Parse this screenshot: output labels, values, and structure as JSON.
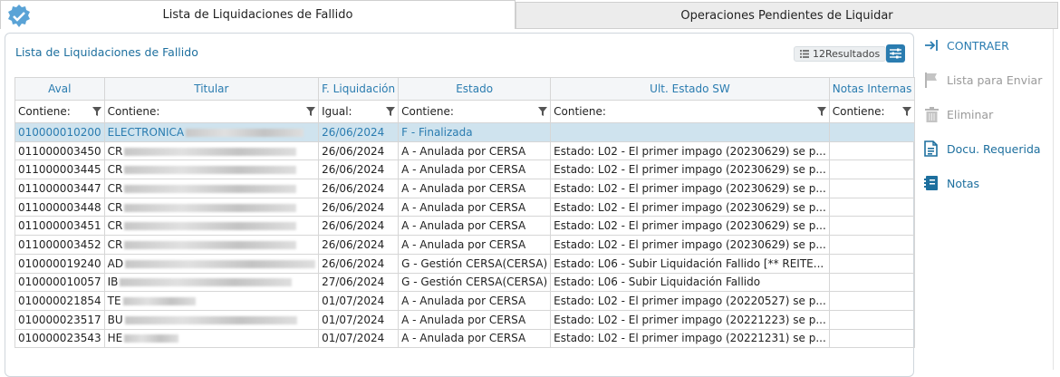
{
  "tabs": [
    {
      "label": "Lista de Liquidaciones de Fallido",
      "active": true
    },
    {
      "label": "Operaciones Pendientes de Liquidar",
      "active": false
    }
  ],
  "panel": {
    "title": "Lista de Liquidaciones de Fallido",
    "results_label": "12Resultados",
    "list_icon": "list-icon",
    "filter_icon": "sliders-icon"
  },
  "table": {
    "columns": [
      "Aval",
      "Titular",
      "F. Liquidación",
      "Estado",
      "Ult. Estado SW",
      "Notas Internas"
    ],
    "filters": [
      "Contiene:",
      "Contiene:",
      "Igual:",
      "Contiene:",
      "Contiene:",
      "Contiene:"
    ],
    "rows": [
      {
        "aval": "010000010200",
        "titular": "ELECTRONICA",
        "fecha": "26/06/2024",
        "estado": "F - Finalizada",
        "sw": "",
        "notas": ""
      },
      {
        "aval": "011000003450",
        "titular": "CR",
        "fecha": "26/06/2024",
        "estado": "A - Anulada por CERSA",
        "sw": "Estado: L02 - El primer impago (20230629) se p...",
        "notas": ""
      },
      {
        "aval": "011000003445",
        "titular": "CR",
        "fecha": "26/06/2024",
        "estado": "A - Anulada por CERSA",
        "sw": "Estado: L02 - El primer impago (20230629) se p...",
        "notas": ""
      },
      {
        "aval": "011000003447",
        "titular": "CR",
        "fecha": "26/06/2024",
        "estado": "A - Anulada por CERSA",
        "sw": "Estado: L02 - El primer impago (20230629) se p...",
        "notas": ""
      },
      {
        "aval": "011000003448",
        "titular": "CR",
        "fecha": "26/06/2024",
        "estado": "A - Anulada por CERSA",
        "sw": "Estado: L02 - El primer impago (20230629) se p...",
        "notas": ""
      },
      {
        "aval": "011000003451",
        "titular": "CR",
        "fecha": "26/06/2024",
        "estado": "A - Anulada por CERSA",
        "sw": "Estado: L02 - El primer impago (20230629) se p...",
        "notas": ""
      },
      {
        "aval": "011000003452",
        "titular": "CR",
        "fecha": "26/06/2024",
        "estado": "A - Anulada por CERSA",
        "sw": "Estado: L02 - El primer impago (20230629) se p...",
        "notas": ""
      },
      {
        "aval": "010000019240",
        "titular": "AD",
        "fecha": "26/06/2024",
        "estado": "G - Gestión CERSA(CERSA)",
        "sw": "Estado: L06 - Subir Liquidación Fallido [** REITE...",
        "notas": ""
      },
      {
        "aval": "010000010057",
        "titular": "IB",
        "fecha": "27/06/2024",
        "estado": "G - Gestión CERSA(CERSA)",
        "sw": "Estado: L06 - Subir Liquidación Fallido",
        "notas": ""
      },
      {
        "aval": "010000021854",
        "titular": "TE",
        "fecha": "01/07/2024",
        "estado": "A - Anulada por CERSA",
        "sw": "Estado: L02 - El primer impago (20220527) se p...",
        "notas": ""
      },
      {
        "aval": "010000023517",
        "titular": "BU",
        "fecha": "01/07/2024",
        "estado": "A - Anulada por CERSA",
        "sw": "Estado: L02 - El primer impago (20221223) se p...",
        "notas": ""
      },
      {
        "aval": "010000023543",
        "titular": "HE",
        "fecha": "01/07/2024",
        "estado": "A - Anulada por CERSA",
        "sw": "Estado: L02 - El primer impago (20221231) se p...",
        "notas": ""
      }
    ]
  },
  "sidebar": {
    "items": [
      {
        "label": "CONTRAER",
        "icon": "collapse-arrow-icon",
        "state": "active"
      },
      {
        "label": "Lista para Enviar",
        "icon": "flag-icon",
        "state": "disabled"
      },
      {
        "label": "Eliminar",
        "icon": "trash-icon",
        "state": "disabled"
      },
      {
        "label": "Docu. Requerida",
        "icon": "document-icon",
        "state": "link"
      },
      {
        "label": "Notas",
        "icon": "notes-icon",
        "state": "link"
      }
    ]
  },
  "colors": {
    "accent": "#2a7cb0",
    "selected_row": "#cfe3ee",
    "header_bg": "#f4f6f8"
  }
}
